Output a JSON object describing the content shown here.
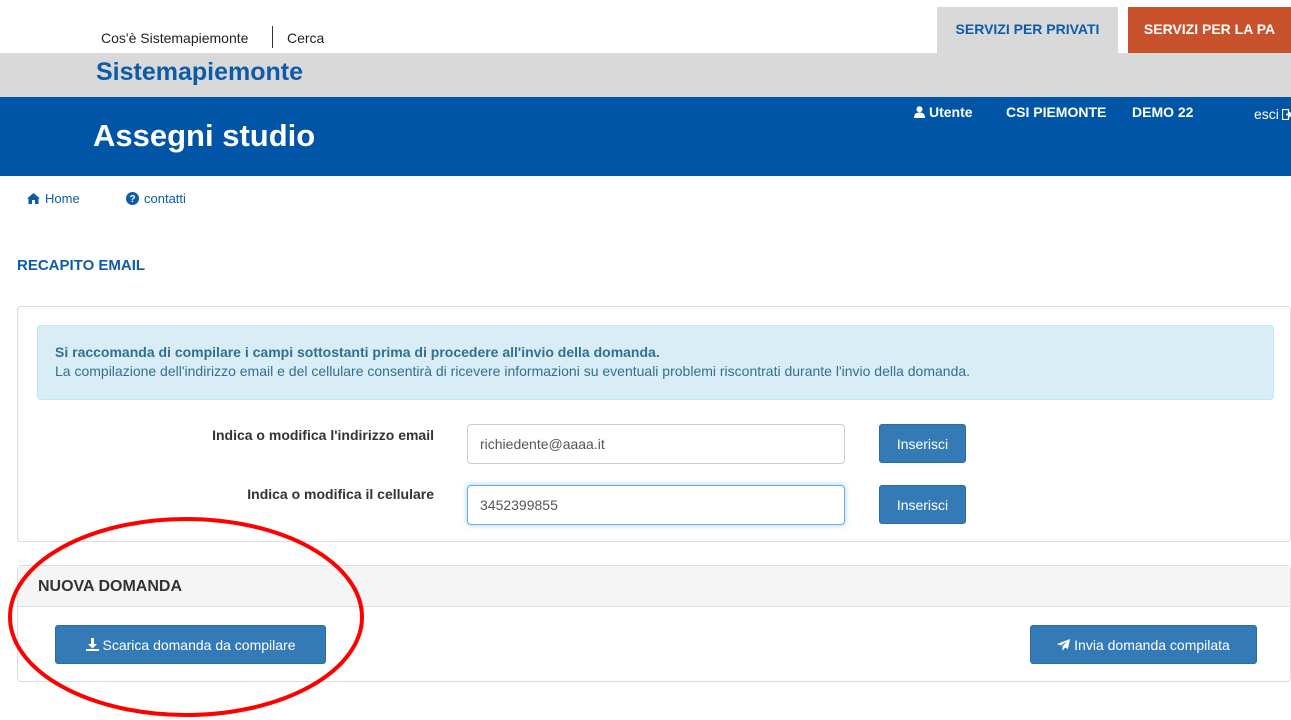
{
  "top_links": {
    "about": "Cos'è Sistemapiemonte",
    "search": "Cerca"
  },
  "tabs": {
    "private": "SERVIZI PER PRIVATI",
    "pa": "SERVIZI PER LA PA"
  },
  "brand": "Sistemapiemonte",
  "app_title": "Assegni studio",
  "user": {
    "label": "Utente",
    "name": "CSI PIEMONTE",
    "code": "DEMO 22",
    "logout": "esci"
  },
  "nav": {
    "home": "Home",
    "contacts": "contatti"
  },
  "section_title": "RECAPITO EMAIL",
  "alert": {
    "title": "Si raccomanda di compilare i campi sottostanti prima di procedere all'invio della domanda.",
    "text": "La compilazione dell'indirizzo email e del cellulare consentirà di ricevere informazioni su eventuali problemi riscontrati durante l'invio della domanda."
  },
  "email": {
    "label": "Indica o modifica l'indirizzo email",
    "value": "richiedente@aaaa.it",
    "button": "Inserisci"
  },
  "phone": {
    "label": "Indica o modifica il cellulare",
    "value": "3452399855",
    "button": "Inserisci"
  },
  "new_request": {
    "title": "NUOVA DOMANDA",
    "download_button": "Scarica domanda da compilare",
    "send_button": "Invia domanda compilata"
  },
  "colors": {
    "primary": "#0055a6",
    "pa_tab": "#c8522c",
    "button": "#337ab7",
    "annotation": "#ff0000"
  },
  "icons": [
    "user-icon",
    "logout-icon",
    "home-icon",
    "question-circle-icon",
    "download-icon",
    "paper-plane-icon"
  ]
}
